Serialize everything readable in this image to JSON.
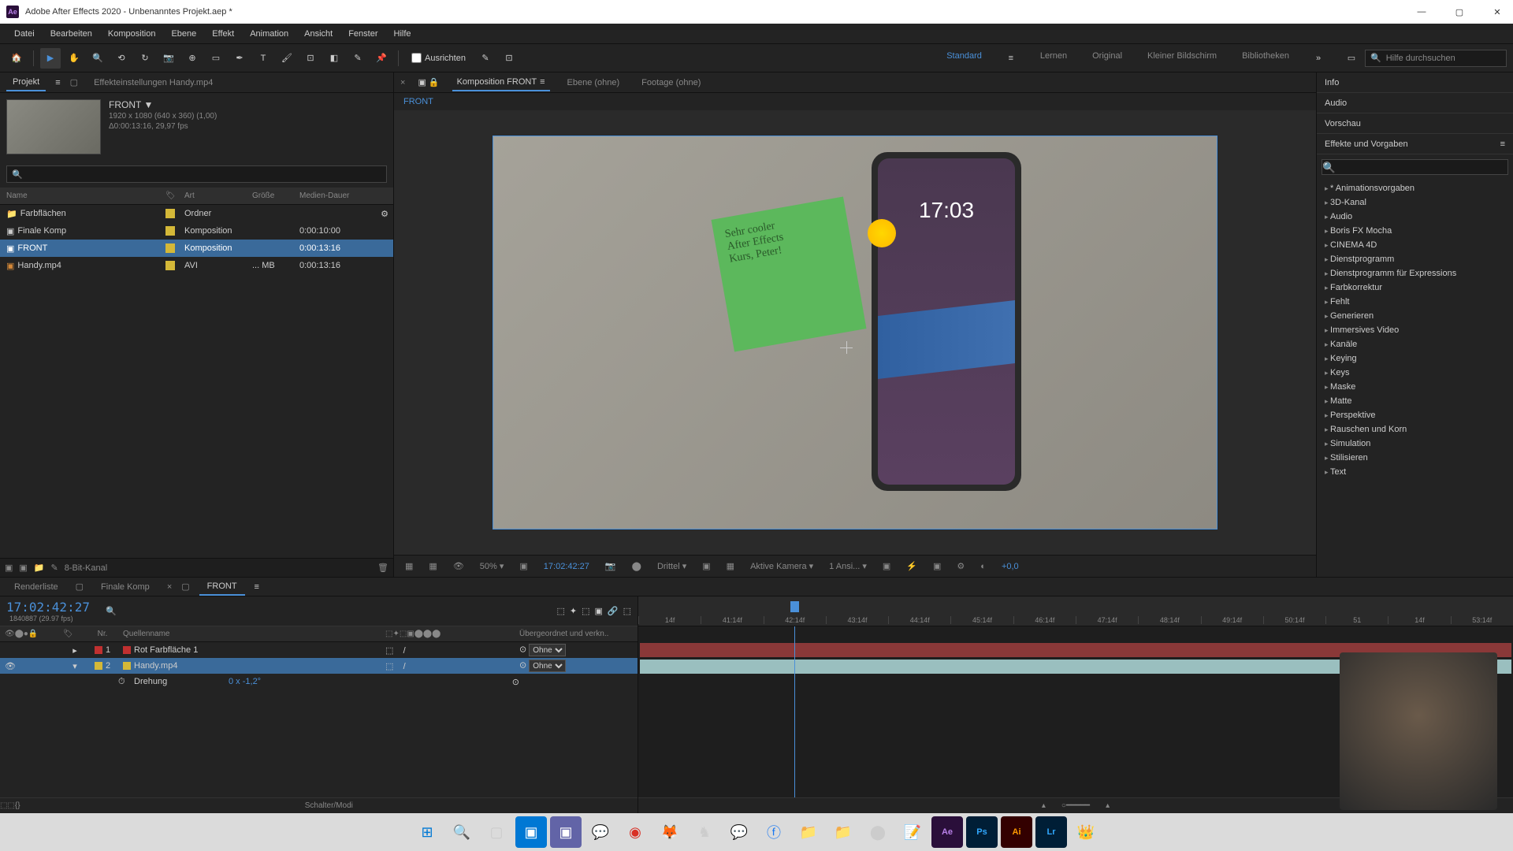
{
  "titlebar": {
    "app_name": "Adobe After Effects 2020 - Unbenanntes Projekt.aep *"
  },
  "menubar": {
    "items": [
      "Datei",
      "Bearbeiten",
      "Komposition",
      "Ebene",
      "Effekt",
      "Animation",
      "Ansicht",
      "Fenster",
      "Hilfe"
    ]
  },
  "toolbar": {
    "align_label": "Ausrichten",
    "workspaces": [
      "Standard",
      "Lernen",
      "Original",
      "Kleiner Bildschirm",
      "Bibliotheken"
    ],
    "search_placeholder": "Hilfe durchsuchen"
  },
  "project_panel": {
    "tab_project": "Projekt",
    "tab_effect_settings": "Effekteinstellungen Handy.mp4",
    "selected_name": "FRONT ▼",
    "selected_dim": "1920 x 1080 (640 x 360) (1,00)",
    "selected_dur": "Δ0:00:13:16, 29,97 fps",
    "headers": {
      "name": "Name",
      "type": "Art",
      "size": "Größe",
      "duration": "Medien-Dauer"
    },
    "items": [
      {
        "name": "Farbflächen",
        "type": "Ordner",
        "size": "",
        "duration": "",
        "color": "#d4b838",
        "icon": "folder"
      },
      {
        "name": "Finale Komp",
        "type": "Komposition",
        "size": "",
        "duration": "0:00:10:00",
        "color": "#d4b838",
        "icon": "comp"
      },
      {
        "name": "FRONT",
        "type": "Komposition",
        "size": "",
        "duration": "0:00:13:16",
        "color": "#d4b838",
        "icon": "comp",
        "selected": true
      },
      {
        "name": "Handy.mp4",
        "type": "AVI",
        "size": "... MB",
        "duration": "0:00:13:16",
        "color": "#d4b838",
        "icon": "video"
      }
    ],
    "bottom_label": "8-Bit-Kanal"
  },
  "comp_viewer": {
    "tab_comp": "Komposition FRONT",
    "tab_layer": "Ebene (ohne)",
    "tab_footage": "Footage (ohne)",
    "breadcrumb": "FRONT",
    "phone_time": "17:03",
    "sticky_text": "Sehr cooler\nAfter Effects\nKurs, Peter!",
    "zoom": "50%",
    "timecode": "17:02:42:27",
    "resolution": "Drittel",
    "camera": "Aktive Kamera",
    "views": "1 Ansi...",
    "exposure": "+0,0"
  },
  "right_panels": {
    "info": "Info",
    "audio": "Audio",
    "preview": "Vorschau",
    "effects_title": "Effekte und Vorgaben",
    "categories": [
      "* Animationsvorgaben",
      "3D-Kanal",
      "Audio",
      "Boris FX Mocha",
      "CINEMA 4D",
      "Dienstprogramm",
      "Dienstprogramm für Expressions",
      "Farbkorrektur",
      "Fehlt",
      "Generieren",
      "Immersives Video",
      "Kanäle",
      "Keying",
      "Keys",
      "Maske",
      "Matte",
      "Perspektive",
      "Rauschen und Korn",
      "Simulation",
      "Stilisieren",
      "Text"
    ]
  },
  "timeline": {
    "tab_render": "Renderliste",
    "tab_finale": "Finale Komp",
    "tab_front": "FRONT",
    "timecode": "17:02:42:27",
    "framecount": "1840887 (29.97 fps)",
    "col_no": "Nr.",
    "col_name": "Quellenname",
    "col_parent": "Übergeordnet und verkn..",
    "layers": [
      {
        "no": "1",
        "name": "Rot Farbfläche 1",
        "color": "#c03030",
        "parent": "Ohne"
      },
      {
        "no": "2",
        "name": "Handy.mp4",
        "color": "#d4b838",
        "parent": "Ohne",
        "selected": true
      }
    ],
    "prop_rotation": "Drehung",
    "prop_rotation_value": "0 x -1,2°",
    "ruler_marks": [
      "14f",
      "41:14f",
      "42:14f",
      "43:14f",
      "44:14f",
      "45:14f",
      "46:14f",
      "47:14f",
      "48:14f",
      "49:14f",
      "50:14f",
      "51",
      "14f",
      "53:14f"
    ],
    "bottom_label": "Schalter/Modi"
  }
}
